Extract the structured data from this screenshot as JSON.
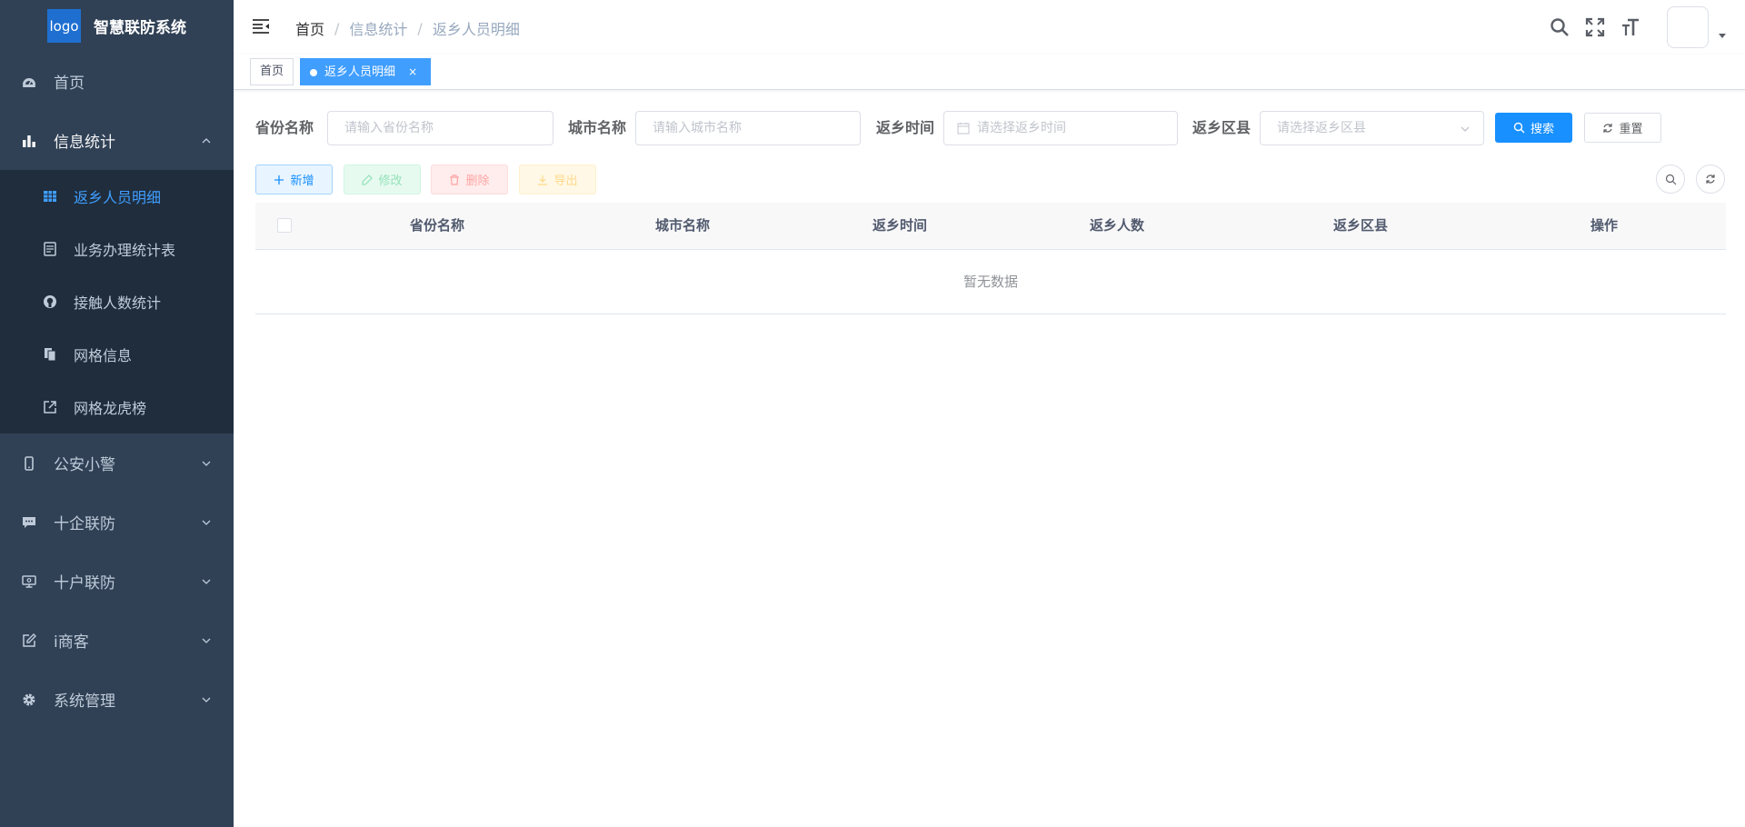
{
  "sidebar": {
    "logo_text": "logo",
    "app_title": "智慧联防系统",
    "menu": {
      "home": "首页",
      "info_stats": "信息统计",
      "police": "公安小警",
      "enterprise": "十企联防",
      "household": "十户联防",
      "merchant": "i商客",
      "system": "系统管理"
    },
    "submenu": {
      "returnees": "返乡人员明细",
      "business_stats": "业务办理统计表",
      "contact_stats": "接触人数统计",
      "grid_info": "网格信息",
      "grid_rank": "网格龙虎榜"
    }
  },
  "navbar": {
    "breadcrumb": [
      "首页",
      "信息统计",
      "返乡人员明细"
    ],
    "separator": "/"
  },
  "tags": {
    "home": "首页",
    "active": "返乡人员明细",
    "close": "×"
  },
  "search_form": {
    "province_label": "省份名称",
    "province_placeholder": "请输入省份名称",
    "city_label": "城市名称",
    "city_placeholder": "请输入城市名称",
    "time_label": "返乡时间",
    "time_placeholder": "请选择返乡时间",
    "district_label": "返乡区县",
    "district_placeholder": "请选择返乡区县",
    "search_button": "搜索",
    "reset_button": "重置"
  },
  "toolbar": {
    "add": "新增",
    "edit": "修改",
    "delete": "删除",
    "export": "导出"
  },
  "table": {
    "columns": [
      "省份名称",
      "城市名称",
      "返乡时间",
      "返乡人数",
      "返乡区县",
      "操作"
    ],
    "empty_text": "暂无数据"
  },
  "colors": {
    "sidebar_bg": "#304156",
    "submenu_bg": "#1f2d3d",
    "primary": "#1890ff",
    "active_menu": "#409eff"
  }
}
